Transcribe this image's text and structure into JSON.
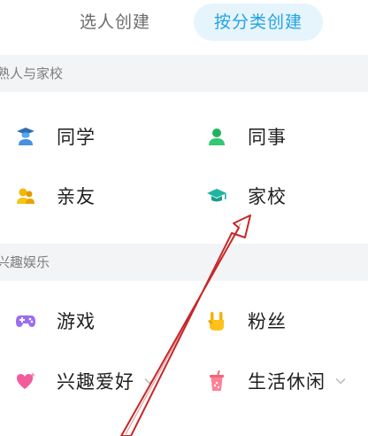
{
  "tabs": {
    "people": "选人创建",
    "category": "按分类创建"
  },
  "sections": [
    {
      "title": "熟人与家校",
      "items": [
        {
          "label": "同学",
          "icon": "student-cap-icon"
        },
        {
          "label": "同事",
          "icon": "person-icon"
        },
        {
          "label": "亲友",
          "icon": "people-pair-icon"
        },
        {
          "label": "家校",
          "icon": "graduation-cap-icon"
        }
      ]
    },
    {
      "title": "兴趣娱乐",
      "items": [
        {
          "label": "游戏",
          "icon": "gamepad-icon"
        },
        {
          "label": "粉丝",
          "icon": "rock-hand-icon"
        },
        {
          "label": "兴趣爱好",
          "icon": "heart-icon"
        },
        {
          "label": "生活休闲",
          "icon": "drink-cup-icon"
        }
      ]
    }
  ],
  "colors": {
    "accent": "#23a3e3",
    "tab_active_bg": "#e6f4fb",
    "section_bg": "#f3f4f6",
    "annotation": "#c62828"
  }
}
